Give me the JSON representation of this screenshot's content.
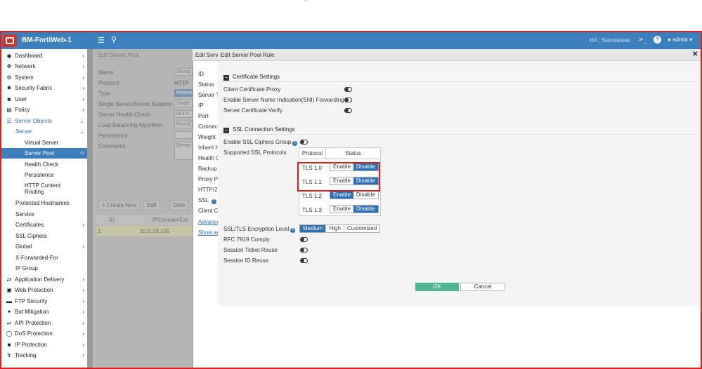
{
  "header": {
    "app_title": "BM-FortiWeb-1",
    "ha_status": "HA : Standalone",
    "user": "admin"
  },
  "sidebar": {
    "items": [
      {
        "label": "Dashboard",
        "icon": "dashboard-icon"
      },
      {
        "label": "Network",
        "icon": "network-icon"
      },
      {
        "label": "System",
        "icon": "gear-icon"
      },
      {
        "label": "Security Fabric",
        "icon": "fabric-icon"
      },
      {
        "label": "User",
        "icon": "user-icon"
      },
      {
        "label": "Policy",
        "icon": "policy-icon"
      },
      {
        "label": "Server Objects",
        "icon": "list-icon"
      },
      {
        "label": "Server"
      },
      {
        "label": "Virtual Server"
      },
      {
        "label": "Server Pool"
      },
      {
        "label": "Health Check"
      },
      {
        "label": "Persistence"
      },
      {
        "label": "HTTP Content Routing"
      },
      {
        "label": "Protected Hostnames"
      },
      {
        "label": "Service"
      },
      {
        "label": "Certificates"
      },
      {
        "label": "SSL Ciphers"
      },
      {
        "label": "Global"
      },
      {
        "label": "X-Forwarded-For"
      },
      {
        "label": "IP Group"
      },
      {
        "label": "Application Delivery",
        "icon": "delivery-icon"
      },
      {
        "label": "Web Protection",
        "icon": "lock-icon"
      },
      {
        "label": "FTP Security",
        "icon": "folder-icon"
      },
      {
        "label": "Bot Mitigation",
        "icon": "bot-icon"
      },
      {
        "label": "API Protection",
        "icon": "api-icon"
      },
      {
        "label": "DoS Protection",
        "icon": "shield-icon"
      },
      {
        "label": "IP Protection",
        "icon": "ip-icon"
      },
      {
        "label": "Tracking",
        "icon": "tracking-icon"
      }
    ]
  },
  "background_page": {
    "title": "Edit Server Pool",
    "rows": [
      {
        "label": "Name",
        "value": "Devop"
      },
      {
        "label": "Protocol",
        "value": "HTTP"
      },
      {
        "label": "Type",
        "value": "Revers"
      },
      {
        "label": "Single Server/Server Balance",
        "value": "Single"
      },
      {
        "label": "Server Health Check",
        "value": "HLTH"
      },
      {
        "label": "Load Balancing Algorithm",
        "value": "Round"
      },
      {
        "label": "Persistence",
        "value": ""
      },
      {
        "label": "Comments",
        "value": "Devap"
      }
    ],
    "toolbar": {
      "create_new": "+ Create New",
      "edit": "Edit",
      "delete": "Dele"
    },
    "table_headers": [
      "ID",
      "IP/Domain/Ext"
    ],
    "table_row": [
      "1",
      "10.5.19.105"
    ]
  },
  "middle_dialog": {
    "title": "Edit Server",
    "rows": [
      "ID",
      "Status",
      "Server Type",
      "IP",
      "Port",
      "Connection",
      "Weight",
      "Inherit Health",
      "Health Check",
      "Backup Server",
      "Proxy Protocol",
      "HTTP/2",
      "SSL",
      "Client Certificate",
      "Advanced",
      "Show advanced"
    ]
  },
  "dialog": {
    "title": "Edit Server Pool Rule",
    "certificate_settings": {
      "header": "Certificate Settings",
      "rows": [
        {
          "label": "Client Certificate Proxy"
        },
        {
          "label": "Enable Server Name Indication(SNI) Forwarding"
        },
        {
          "label": "Server Certificate Verify"
        }
      ]
    },
    "ssl_settings": {
      "header": "SSL Connection Settings",
      "enable_ciphers_group": "Enable SSL Ciphers Group",
      "supported_protocols": "Supported SSL Protocols",
      "table_headers": {
        "protocol": "Protocol",
        "status": "Status"
      },
      "protocols": [
        {
          "name": "TLS 1.0",
          "enable": "Enable",
          "disable": "Disable",
          "selected": "disable"
        },
        {
          "name": "TLS 1.1",
          "enable": "Enable",
          "disable": "Disable",
          "selected": "disable"
        },
        {
          "name": "TLS 1.2",
          "enable": "Enable",
          "disable": "Disable",
          "selected": "enable"
        },
        {
          "name": "TLS 1.3",
          "enable": "Enable",
          "disable": "Disable",
          "selected": "disable"
        }
      ],
      "encryption_level_label": "SSL/TLS Encryption Level",
      "encryption_levels": [
        "Medium",
        "High",
        "Customized"
      ],
      "encryption_selected": "Medium",
      "rfc_comply": "RFC 7919 Comply",
      "session_ticket": "Session Ticket Reuse",
      "session_id": "Session ID Reuse"
    },
    "ok": "OK",
    "cancel": "Cancel"
  },
  "colors": {
    "header_bg": "#3b7fbd",
    "accent": "#2e6fb5",
    "ok_button": "#4fb592",
    "highlight": "#d62020"
  }
}
